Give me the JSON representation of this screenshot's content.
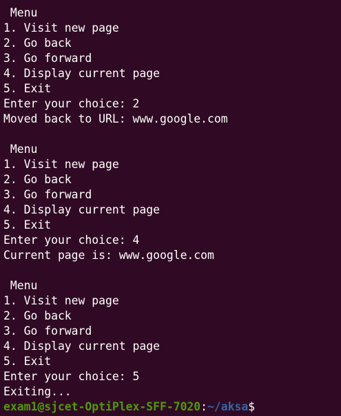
{
  "terminal": {
    "lines": [
      " Menu",
      "1. Visit new page",
      "2. Go back",
      "3. Go forward",
      "4. Display current page",
      "5. Exit",
      "Enter your choice: 2",
      "Moved back to URL: www.google.com",
      "",
      " Menu",
      "1. Visit new page",
      "2. Go back",
      "3. Go forward",
      "4. Display current page",
      "5. Exit",
      "Enter your choice: 4",
      "Current page is: www.google.com",
      "",
      " Menu",
      "1. Visit new page",
      "2. Go back",
      "3. Go forward",
      "4. Display current page",
      "5. Exit",
      "Enter your choice: 5",
      "Exiting..."
    ],
    "prompt": {
      "user_host": "exam1@sjcet-OptiPlex-SFF-7020",
      "separator": ":",
      "path": "~/aksa",
      "symbol": "$"
    }
  },
  "colors": {
    "background": "#300a24",
    "text": "#ffffff",
    "prompt_user": "#4e9a06",
    "prompt_path": "#3465a4"
  }
}
